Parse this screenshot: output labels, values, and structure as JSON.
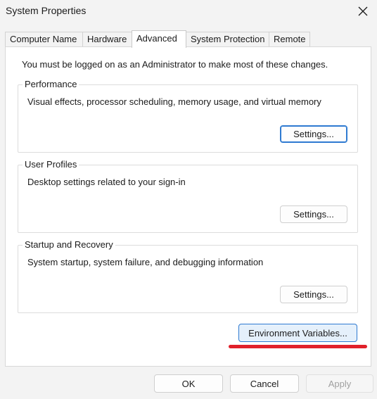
{
  "window": {
    "title": "System Properties",
    "close_icon": "close-icon"
  },
  "tabs": [
    {
      "label": "Computer Name",
      "active": false
    },
    {
      "label": "Hardware",
      "active": false
    },
    {
      "label": "Advanced",
      "active": true
    },
    {
      "label": "System Protection",
      "active": false
    },
    {
      "label": "Remote",
      "active": false
    }
  ],
  "advanced": {
    "admin_note": "You must be logged on as an Administrator to make most of these changes.",
    "performance": {
      "title": "Performance",
      "description": "Visual effects, processor scheduling, memory usage, and virtual memory",
      "button": "Settings..."
    },
    "user_profiles": {
      "title": "User Profiles",
      "description": "Desktop settings related to your sign-in",
      "button": "Settings..."
    },
    "startup_recovery": {
      "title": "Startup and Recovery",
      "description": "System startup, system failure, and debugging information",
      "button": "Settings..."
    },
    "env_button": "Environment Variables..."
  },
  "footer": {
    "ok": "OK",
    "cancel": "Cancel",
    "apply": "Apply"
  },
  "colors": {
    "accent": "#2e7ad1",
    "highlight": "#e0202a"
  }
}
